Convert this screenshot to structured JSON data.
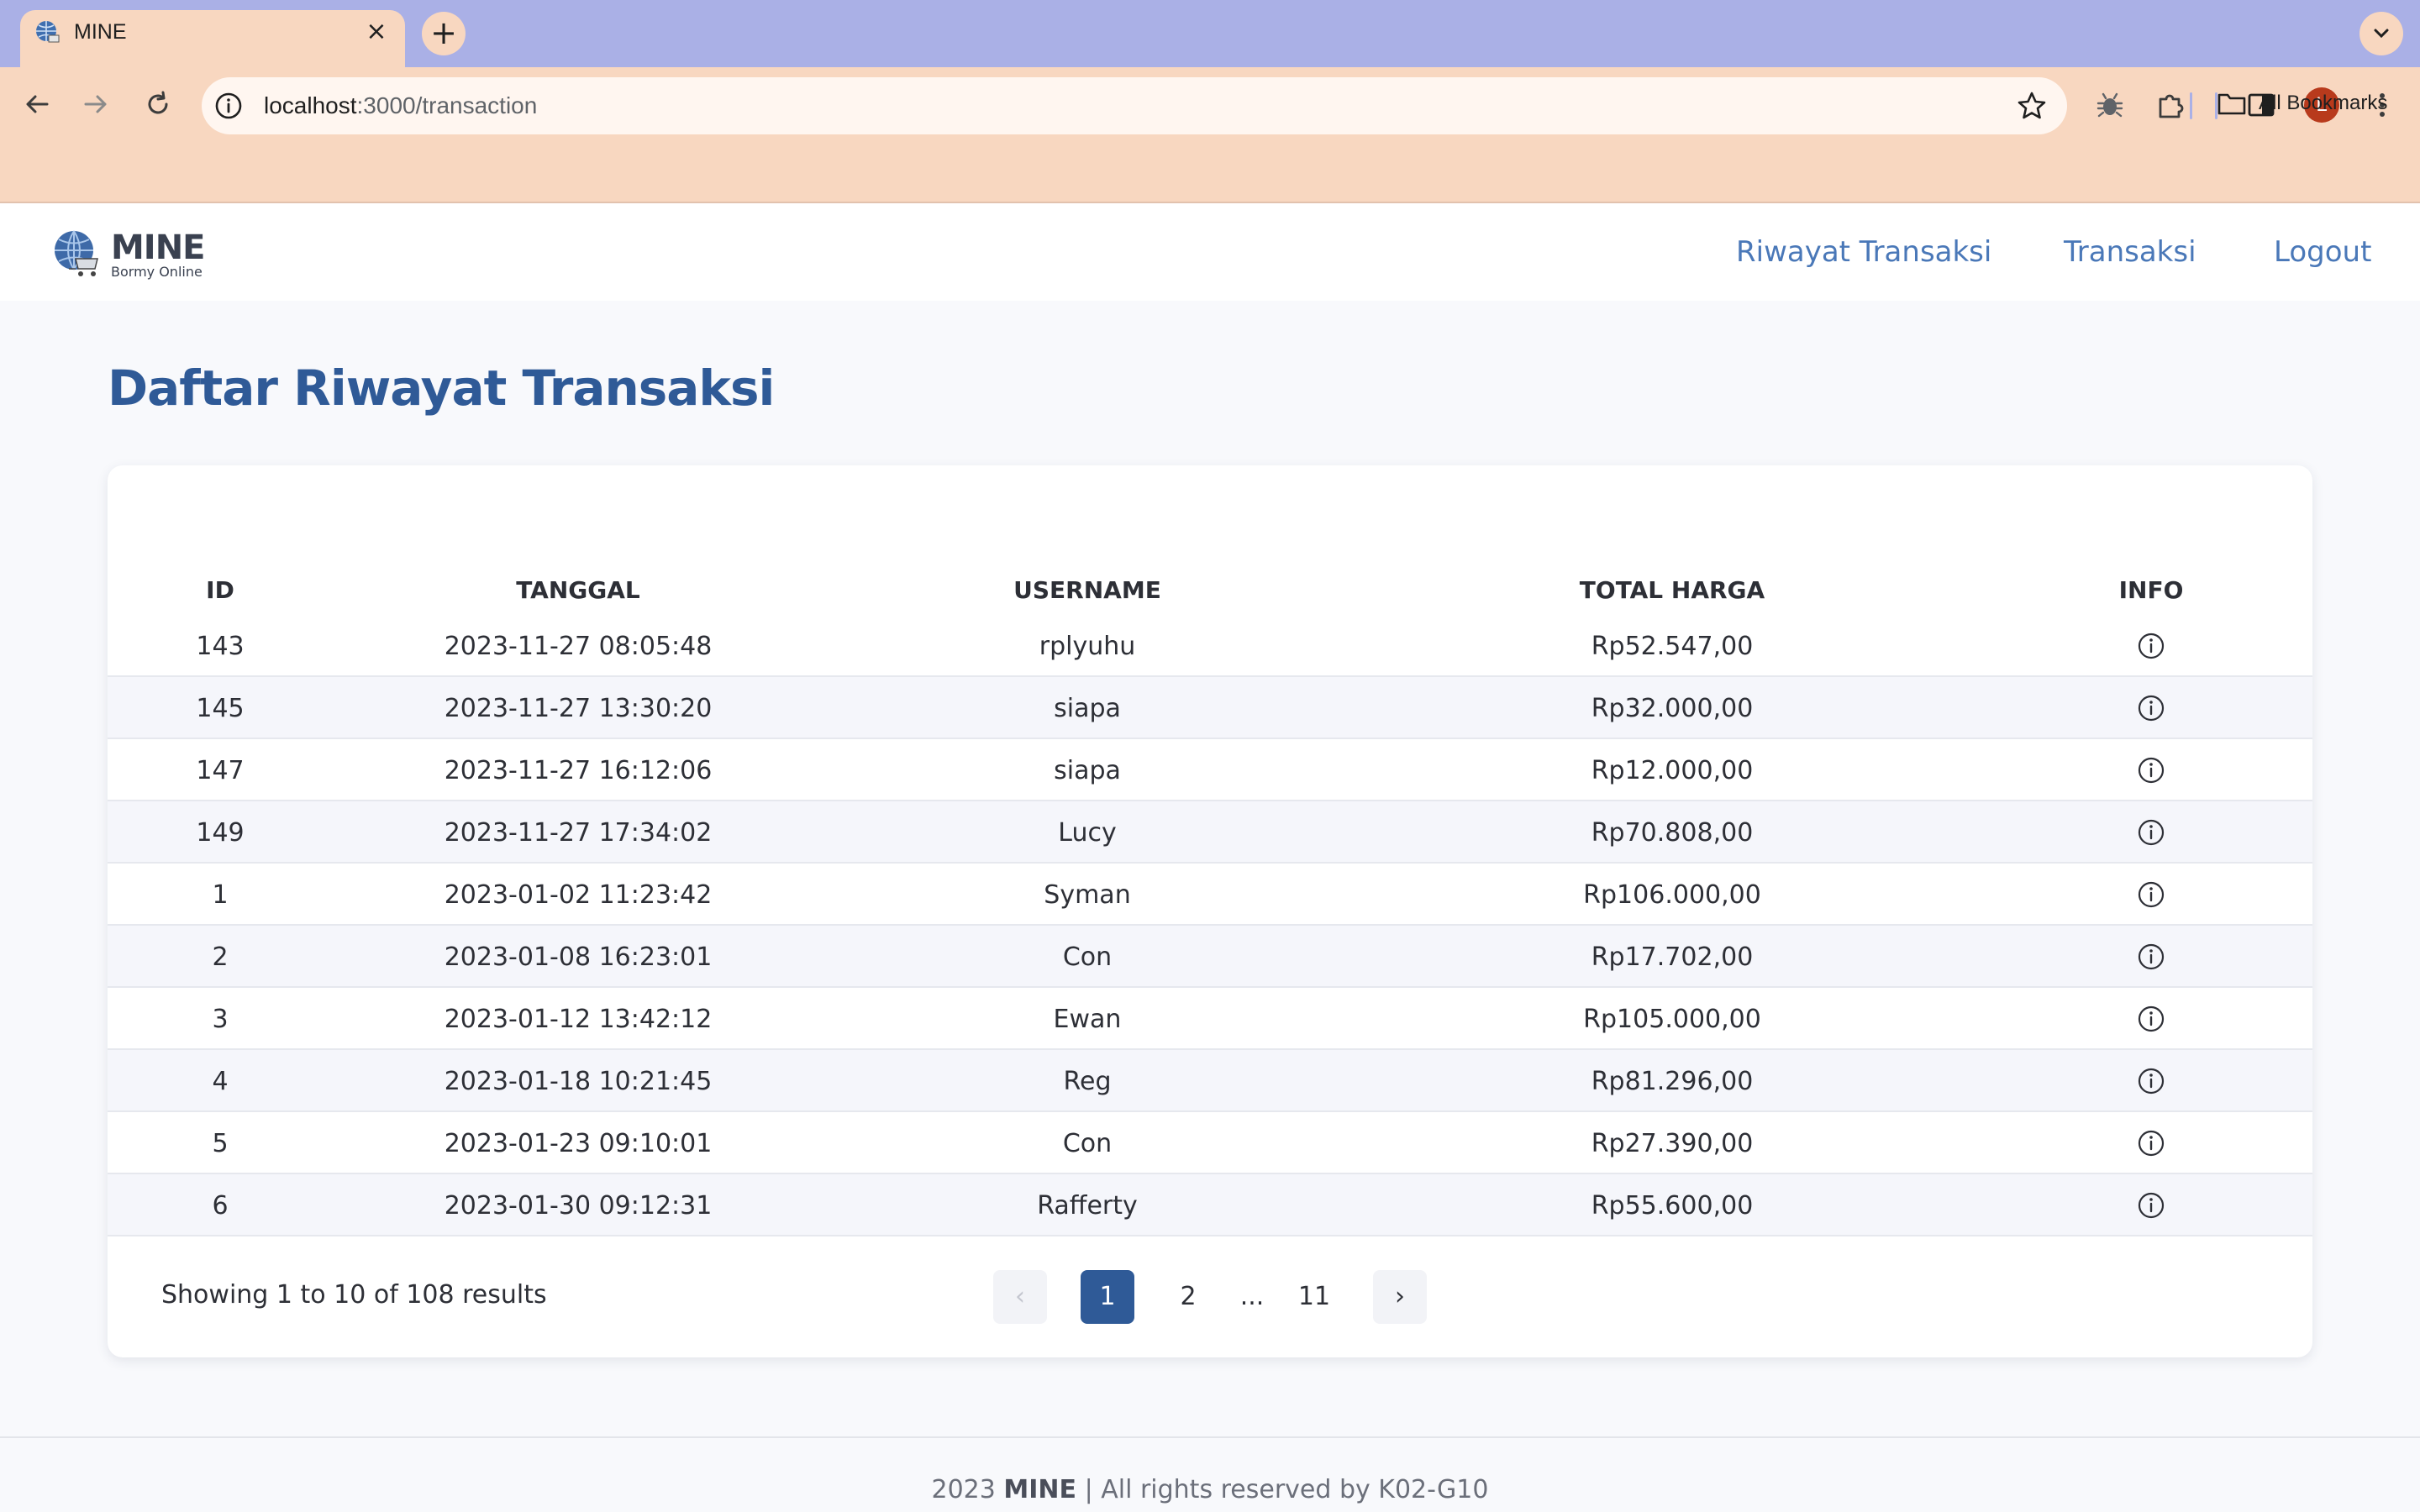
{
  "browser": {
    "tab_title": "MINE",
    "url_host": "localhost",
    "url_path": ":3000/transaction",
    "profile_initial": "L",
    "bookmarks_label": "All Bookmarks"
  },
  "app": {
    "brand": "MINE",
    "brand_sub": "Bormy Online",
    "nav": {
      "history": "Riwayat Transaksi",
      "transaction": "Transaksi",
      "logout": "Logout"
    }
  },
  "page": {
    "title": "Daftar Riwayat Transaksi"
  },
  "table": {
    "headers": [
      "ID",
      "TANGGAL",
      "USERNAME",
      "TOTAL HARGA",
      "INFO"
    ],
    "rows": [
      {
        "id": "143",
        "date": "2023-11-27 08:05:48",
        "username": "rplyuhu",
        "total": "Rp52.547,00"
      },
      {
        "id": "145",
        "date": "2023-11-27 13:30:20",
        "username": "siapa",
        "total": "Rp32.000,00"
      },
      {
        "id": "147",
        "date": "2023-11-27 16:12:06",
        "username": "siapa",
        "total": "Rp12.000,00"
      },
      {
        "id": "149",
        "date": "2023-11-27 17:34:02",
        "username": "Lucy",
        "total": "Rp70.808,00"
      },
      {
        "id": "1",
        "date": "2023-01-02 11:23:42",
        "username": "Syman",
        "total": "Rp106.000,00"
      },
      {
        "id": "2",
        "date": "2023-01-08 16:23:01",
        "username": "Con",
        "total": "Rp17.702,00"
      },
      {
        "id": "3",
        "date": "2023-01-12 13:42:12",
        "username": "Ewan",
        "total": "Rp105.000,00"
      },
      {
        "id": "4",
        "date": "2023-01-18 10:21:45",
        "username": "Reg",
        "total": "Rp81.296,00"
      },
      {
        "id": "5",
        "date": "2023-01-23 09:10:01",
        "username": "Con",
        "total": "Rp27.390,00"
      },
      {
        "id": "6",
        "date": "2023-01-30 09:12:31",
        "username": "Rafferty",
        "total": "Rp55.600,00"
      }
    ]
  },
  "pagination": {
    "summary": "Showing 1 to 10 of 108 results",
    "pages": [
      "1",
      "2",
      "...",
      "11"
    ],
    "current": "1",
    "prev_symbol": "‹",
    "next_symbol": "›"
  },
  "footer": {
    "year": "2023",
    "brand": "MINE",
    "rest": "| All rights reserved by K02-G10"
  },
  "colors": {
    "primary": "#2f5a97",
    "nav_link": "#4a78b8",
    "tabbar": "#aab0e6",
    "toolbar": "#f8d7c0"
  }
}
